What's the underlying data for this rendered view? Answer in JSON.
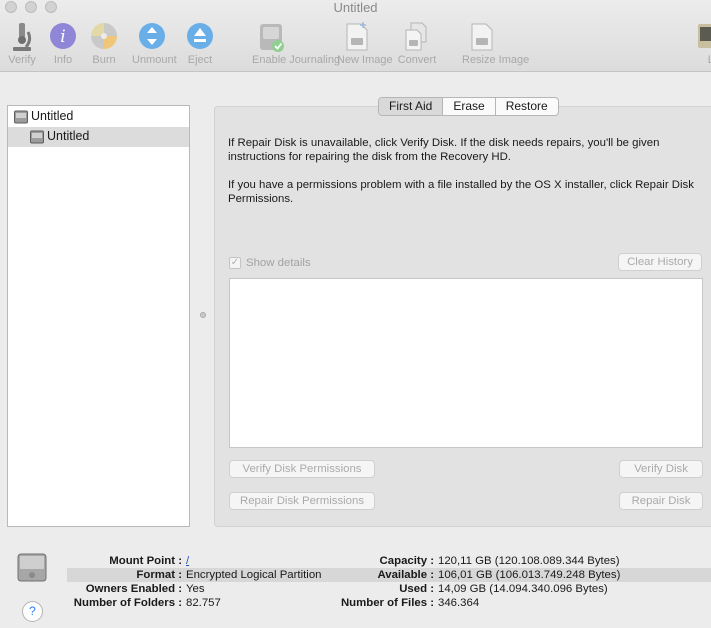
{
  "window": {
    "title": "Untitled"
  },
  "toolbar": {
    "items": [
      {
        "label": "Verify",
        "icon": "microscope-icon"
      },
      {
        "label": "Info",
        "icon": "info-icon"
      },
      {
        "label": "Burn",
        "icon": "burn-icon"
      },
      {
        "label": "Unmount",
        "icon": "unmount-icon"
      },
      {
        "label": "Eject",
        "icon": "eject-icon"
      },
      {
        "label": "Enable Journaling",
        "icon": "journaling-icon"
      },
      {
        "label": "New Image",
        "icon": "new-image-icon"
      },
      {
        "label": "Convert",
        "icon": "convert-icon"
      },
      {
        "label": "Resize Image",
        "icon": "resize-image-icon"
      },
      {
        "label": "Lo",
        "icon": "log-icon"
      }
    ]
  },
  "sidebar": {
    "items": [
      {
        "name": "Untitled",
        "level": 0,
        "selected": false
      },
      {
        "name": "Untitled",
        "level": 1,
        "selected": true
      }
    ]
  },
  "tabs": [
    {
      "label": "First Aid",
      "active": true
    },
    {
      "label": "Erase",
      "active": false
    },
    {
      "label": "Restore",
      "active": false
    }
  ],
  "first_aid": {
    "para1": "If Repair Disk is unavailable, click Verify Disk. If the disk needs repairs, you'll be given instructions for repairing the disk from the Recovery HD.",
    "para2": "If you have a permissions problem with a file installed by the OS X installer, click Repair Disk Permissions.",
    "show_details_label": "Show details",
    "show_details_checked": true,
    "clear_history_label": "Clear History",
    "verify_permissions_label": "Verify Disk Permissions",
    "verify_disk_label": "Verify Disk",
    "repair_permissions_label": "Repair Disk Permissions",
    "repair_disk_label": "Repair Disk"
  },
  "info": {
    "mount_point_label": "Mount Point :",
    "mount_point_value": "/",
    "format_label": "Format :",
    "format_value": "Encrypted Logical Partition",
    "owners_label": "Owners Enabled :",
    "owners_value": "Yes",
    "folders_label": "Number of Folders :",
    "folders_value": "82.757",
    "capacity_label": "Capacity :",
    "capacity_value": "120,11 GB (120.108.089.344 Bytes)",
    "available_label": "Available :",
    "available_value": "106,01 GB (106.013.749.248 Bytes)",
    "used_label": "Used :",
    "used_value": "14,09 GB (14.094.340.096 Bytes)",
    "files_label": "Number of Files :",
    "files_value": "346.364",
    "help_label": "?"
  },
  "colors": {
    "accent": "#2f7cf6",
    "disabled_text": "#a8a8a8"
  }
}
